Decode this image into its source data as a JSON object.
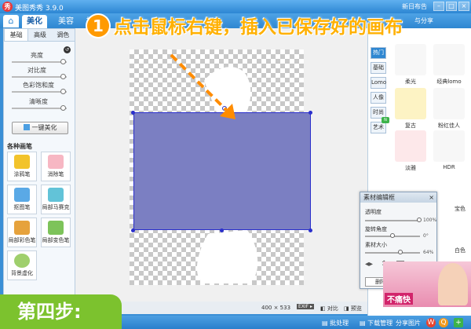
{
  "app": {
    "title": "美图秀秀 3.9.0",
    "logo_glyph": "秀",
    "top_right": "新日布告",
    "share_label": "分享到 ▾"
  },
  "tabs": [
    {
      "label": "美化"
    },
    {
      "label": "美容"
    },
    {
      "label": "拼图"
    }
  ],
  "tab_right": "与分享",
  "left_panel": {
    "subtabs": [
      "基础",
      "高级",
      "调色"
    ],
    "sliders": [
      {
        "label": "亮度",
        "value": 0.5
      },
      {
        "label": "对比度",
        "value": 0.5
      },
      {
        "label": "色彩饱和度",
        "value": 0.5
      },
      {
        "label": "清晰度",
        "value": 0.5
      }
    ],
    "one_key_button": "一键美化",
    "brush_header": "各种画笔",
    "tools": [
      {
        "label": "涂鸦笔",
        "color": "#f2c32b"
      },
      {
        "label": "消除笔",
        "color": "#f7b7c3"
      },
      {
        "label": "抠图笔",
        "color": "#5aa9e6"
      },
      {
        "label": "局部马赛克",
        "color": "#62c3d8"
      },
      {
        "label": "局部彩色笔",
        "color": "#e6a23c"
      },
      {
        "label": "局部变色笔",
        "color": "#7dc35a"
      },
      {
        "label": "背景虚化",
        "color": "#9fcf6c"
      }
    ]
  },
  "canvas": {
    "size_text": "400 × 533",
    "compare_label": "对比",
    "preview_label": "预览",
    "zoom_label": "EXIF ▸"
  },
  "instruction": {
    "step_number": "1",
    "text": "点击鼠标右键，插入已保存好的画布"
  },
  "step_badge": "第四步:",
  "right_panel": {
    "tabs": [
      "热门",
      "基础",
      "Lomo",
      "人像",
      "时尚",
      "艺术"
    ],
    "effects": [
      {
        "label": "柔光",
        "color": "#ffffff"
      },
      {
        "label": "经典lomo",
        "color": "#ffffff"
      },
      {
        "label": "复古",
        "color": "#fdf3c4"
      },
      {
        "label": "粉红佳人",
        "color": "#ffffff"
      },
      {
        "label": "淡雅",
        "color": "#fde8ea"
      },
      {
        "label": "HDR",
        "color": "#ffffff"
      },
      {
        "label": "",
        "color": "#ffffff"
      },
      {
        "label": "宝色",
        "color": "#ffffff"
      },
      {
        "label": "",
        "color": "#ffffff"
      },
      {
        "label": "白色",
        "color": "#ffffff"
      }
    ]
  },
  "material_panel": {
    "title": "素材编辑框",
    "close": "×",
    "opacity_label": "透明度",
    "opacity_value": "100%",
    "rotate_label": "旋转角度",
    "rotate_value": "0°",
    "size_label": "素材大小",
    "size_value": "64%",
    "delete_button": "删除本素材"
  },
  "ad": {
    "text": "不痛快"
  },
  "bottom_bar": {
    "batch": "批处理",
    "download": "下载管理",
    "share": "分享图片"
  }
}
